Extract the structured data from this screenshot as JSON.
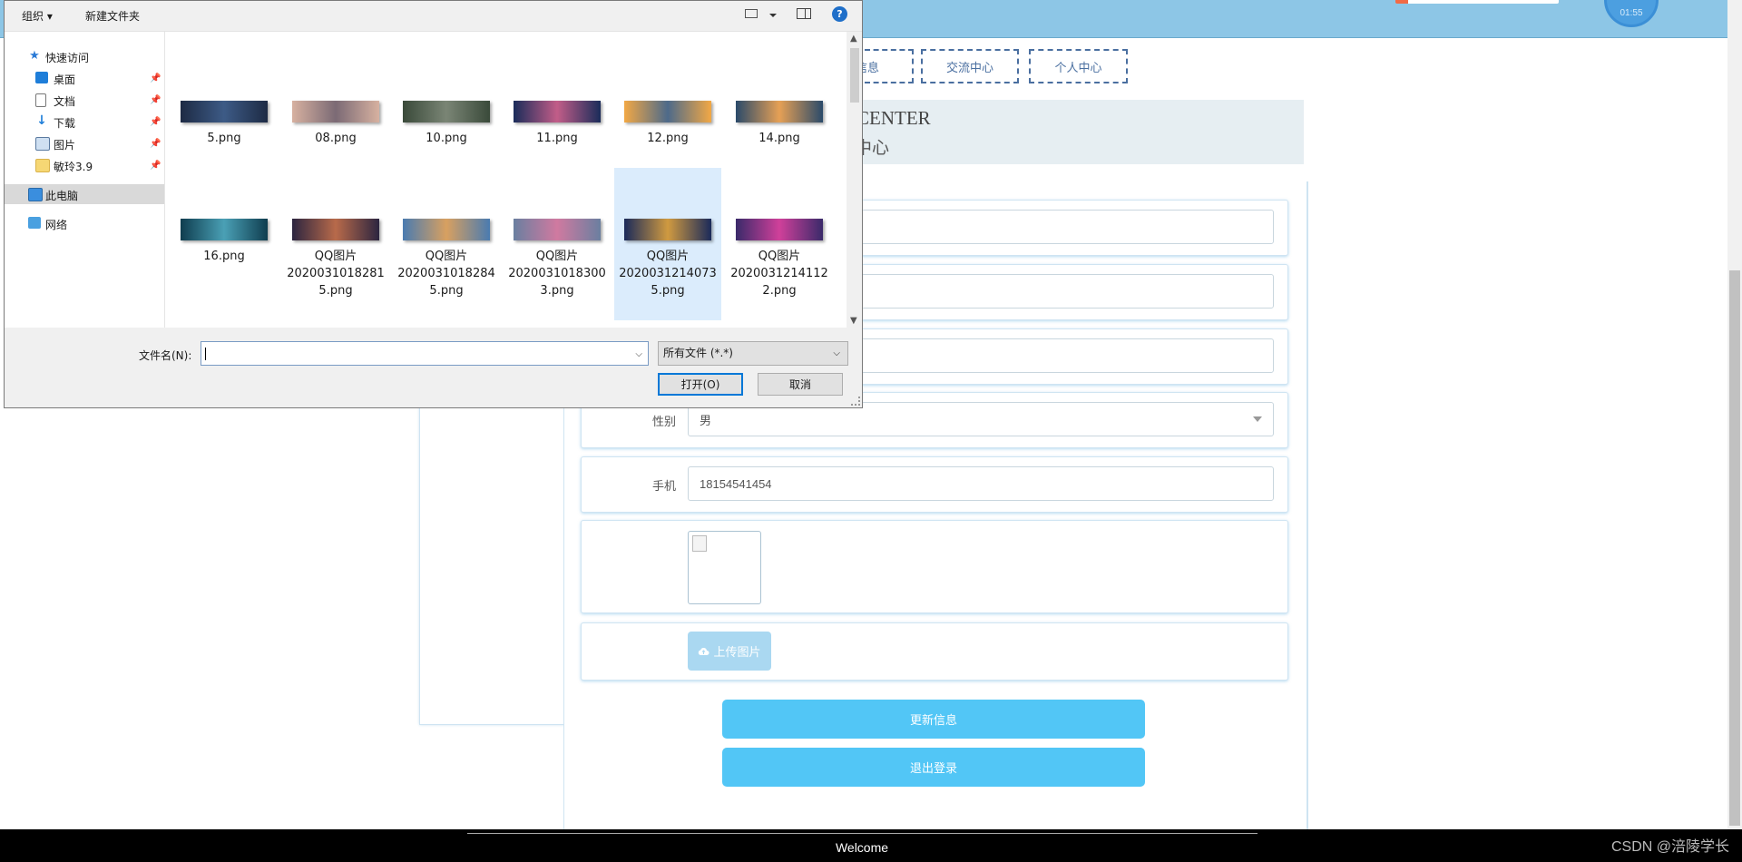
{
  "header": {
    "clock_text": "01:55"
  },
  "nav": {
    "items": [
      "信息",
      "交流中心",
      "个人中心"
    ]
  },
  "banner": {
    "en": "CENTER",
    "cn": "中心"
  },
  "form": {
    "gender_label": "性别",
    "gender_value": "男",
    "phone_label": "手机",
    "phone_value": "18154541454",
    "upload_label": "上传图片",
    "update_button": "更新信息",
    "logout_button": "退出登录"
  },
  "footer": {
    "welcome": "Welcome",
    "watermark": "CSDN @涪陵学长"
  },
  "dialog": {
    "toolbar": {
      "organize": "组织 ▾",
      "new_folder": "新建文件夹",
      "help": "?"
    },
    "nav_items": [
      {
        "label": "快速访问",
        "icon": "star-icon",
        "pinned": false
      },
      {
        "label": "桌面",
        "icon": "desktop-icon",
        "pinned": true
      },
      {
        "label": "文档",
        "icon": "document-icon",
        "pinned": true
      },
      {
        "label": "下载",
        "icon": "download-icon",
        "pinned": true
      },
      {
        "label": "图片",
        "icon": "pictures-icon",
        "pinned": true
      },
      {
        "label": "敏玲3.9",
        "icon": "folder-icon",
        "pinned": true
      },
      {
        "label": "此电脑",
        "icon": "computer-icon",
        "pinned": false
      },
      {
        "label": "网络",
        "icon": "network-icon",
        "pinned": false
      }
    ],
    "files": [
      {
        "name": "5.png"
      },
      {
        "name": "08.png"
      },
      {
        "name": "10.png"
      },
      {
        "name": "11.png"
      },
      {
        "name": "12.png"
      },
      {
        "name": "14.png"
      },
      {
        "name": "16.png"
      },
      {
        "name": "QQ图片\n2020031018281\n5.png"
      },
      {
        "name": "QQ图片\n2020031018284\n5.png"
      },
      {
        "name": "QQ图片\n2020031018300\n3.png"
      },
      {
        "name": "QQ图片\n2020031214073\n5.png"
      },
      {
        "name": "QQ图片\n2020031214112\n2.png"
      }
    ],
    "selected_file_index": 10,
    "filename_label": "文件名(N):",
    "filename_value": "",
    "filetype_value": "所有文件 (*.*)",
    "open_button": "打开(O)",
    "cancel_button": "取消",
    "colors": {
      "thumbs": [
        [
          "#1d2a44",
          "#3d5b86"
        ],
        [
          "#d7b1a0",
          "#7b6a75"
        ],
        [
          "#3a4a3a",
          "#7a8575"
        ],
        [
          "#1a2c5a",
          "#c25d88"
        ],
        [
          "#f2a845",
          "#4d6a8a"
        ],
        [
          "#2a4a6a",
          "#e6a055"
        ],
        [
          "#0f3d4f",
          "#4aa0b5"
        ],
        [
          "#2c2540",
          "#b86a4a"
        ],
        [
          "#4a7bb0",
          "#d8a060"
        ],
        [
          "#6a7fa0",
          "#d07aa0"
        ],
        [
          "#1a2a5a",
          "#d09a40"
        ],
        [
          "#3a2a6a",
          "#d0409a"
        ]
      ]
    }
  }
}
